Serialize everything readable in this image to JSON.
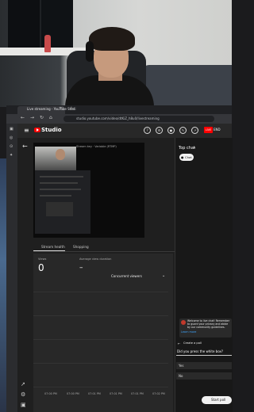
{
  "browser": {
    "tab_title": "Live streaming - YouTube Studi",
    "url": "studio.youtube.com/video/dtKiZ_h8u0/livestreaming",
    "nav_icons": [
      "back-icon",
      "forward-icon",
      "reload-icon"
    ]
  },
  "studio": {
    "brand": "Studio",
    "live_badge": "LIVE",
    "end_label": "END"
  },
  "preview": {
    "badge": "Stream key · Variable (RTMP)"
  },
  "tabs": [
    {
      "label": "Stream health"
    },
    {
      "label": "Shopping"
    }
  ],
  "analytics": {
    "views_label": "Views",
    "views_value": "0",
    "avg_label": "Average view duration",
    "avg_value": "–",
    "dropdown_label": "Concurrent viewers",
    "ticks": [
      "07:00 PM",
      "07:00 PM",
      "07:01 PM",
      "07:01 PM",
      "07:01 PM",
      "07:02 PM",
      "07:02 PM"
    ]
  },
  "chat": {
    "title": "Top chat",
    "chip": "Chat",
    "welcome": "Welcome to live chat! Remember to guard your privacy and abide by our community guidelines.",
    "learn_more": "Learn more",
    "poll_header": "Create a poll",
    "question": "Did you press the white box?",
    "options": [
      "Yes",
      "No"
    ],
    "start_poll": "Start poll"
  },
  "colors": {
    "accent_red": "#ff0000",
    "link_blue": "#3ea6ff"
  }
}
